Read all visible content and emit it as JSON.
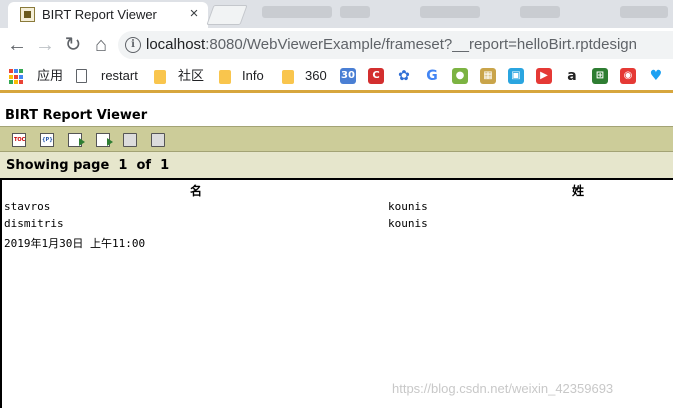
{
  "browser": {
    "tab_title": "BIRT Report Viewer",
    "tab_close": "×",
    "url_host": "localhost",
    "url_rest": ":8080/WebViewerExample/frameset?__report=helloBirt.rptdesign",
    "info_icon": "i",
    "back_icon": "←",
    "forward_icon": "→",
    "reload_icon": "↻",
    "home_icon": "⌂"
  },
  "bookmarks": [
    {
      "label": "应用",
      "icon": "apps-grid-icon"
    },
    {
      "label": "restart",
      "icon": "page-icon"
    },
    {
      "label": "社区",
      "icon": "folder-icon"
    },
    {
      "label": "Info",
      "icon": "folder-icon"
    },
    {
      "label": "360",
      "icon": "folder-icon"
    }
  ],
  "bookmark_icons": [
    {
      "name": "calendar-icon",
      "color": "#4a7fd4",
      "glyph": "30"
    },
    {
      "name": "c-icon",
      "color": "#d32f2f",
      "glyph": "C"
    },
    {
      "name": "baidu-paw-icon",
      "color": "#2f6fd6",
      "glyph": "✿"
    },
    {
      "name": "google-icon",
      "color": "#4285f4",
      "glyph": "G"
    },
    {
      "name": "green-circle-icon",
      "color": "#7cb342",
      "glyph": "●"
    },
    {
      "name": "folder-box-icon",
      "color": "#c9a44a",
      "glyph": "▦"
    },
    {
      "name": "bilibili-icon",
      "color": "#2aa5e0",
      "glyph": "▣"
    },
    {
      "name": "youtube-icon",
      "color": "#e53935",
      "glyph": "▶"
    },
    {
      "name": "amazon-icon",
      "color": "#222222",
      "glyph": "a"
    },
    {
      "name": "green-box-icon",
      "color": "#2e7d32",
      "glyph": "⊞"
    },
    {
      "name": "weibo-icon",
      "color": "#e53935",
      "glyph": "◉"
    },
    {
      "name": "twitter-icon",
      "color": "#1da1f2",
      "glyph": "♥"
    }
  ],
  "viewer": {
    "title": "BIRT Report Viewer",
    "page_label": "Showing page",
    "page_current": "1",
    "page_of": "of",
    "page_total": "1"
  },
  "report": {
    "headers": [
      "名",
      "姓"
    ],
    "rows": [
      [
        "stavros",
        "kounis"
      ],
      [
        "dismitris",
        "kounis"
      ]
    ],
    "footer_date": "2019年1月30日 上午11:00"
  },
  "watermark": "https://blog.csdn.net/weixin_42359693",
  "colors": {
    "toolbar": "#cccc99",
    "pagebar": "#e6e6cc",
    "accent_line": "#d7a63d"
  }
}
